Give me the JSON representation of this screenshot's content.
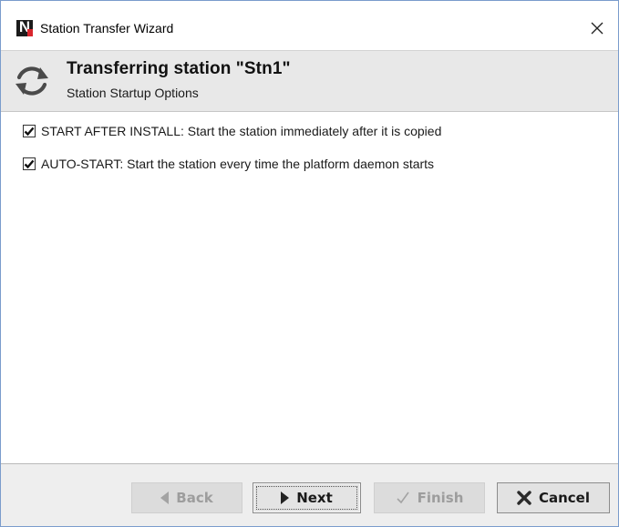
{
  "window": {
    "title": "Station Transfer Wizard"
  },
  "header": {
    "title": "Transferring station \"Stn1\"",
    "subtitle": "Station Startup Options"
  },
  "options": [
    {
      "label": "START AFTER INSTALL: Start the station immediately after it is copied",
      "checked": true
    },
    {
      "label": "AUTO-START: Start the station every time the platform daemon starts",
      "checked": true
    }
  ],
  "buttons": {
    "back": {
      "label": "Back",
      "enabled": false
    },
    "next": {
      "label": "Next",
      "enabled": true
    },
    "finish": {
      "label": "Finish",
      "enabled": false
    },
    "cancel": {
      "label": "Cancel",
      "enabled": true
    }
  },
  "icons": {
    "app": "niagara-logo-icon",
    "close": "close-icon",
    "header": "refresh-icon",
    "back": "triangle-left-icon",
    "next": "triangle-right-icon",
    "finish": "checkmark-icon",
    "cancel": "x-icon"
  },
  "colors": {
    "logo_red": "#d8262d",
    "header_bg": "#e8e8e8",
    "footer_bg": "#eeeeee"
  }
}
